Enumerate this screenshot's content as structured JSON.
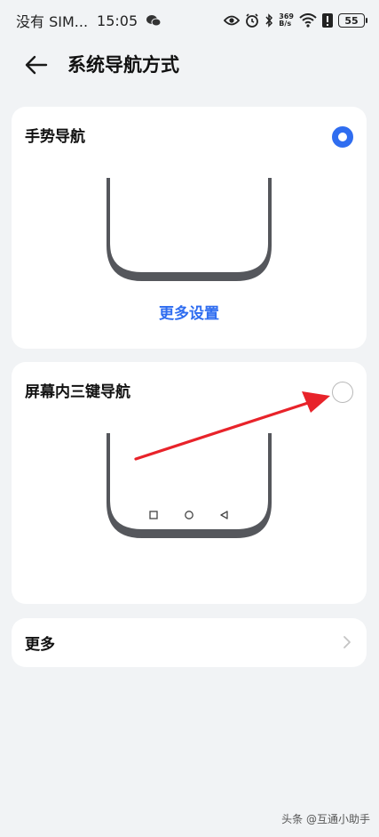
{
  "status_bar": {
    "carrier": "没有 SIM...",
    "time": "15:05",
    "net_speed_value": "369",
    "net_speed_unit": "B/s",
    "battery": "55",
    "icons": [
      "wechat-icon",
      "eye-icon",
      "alarm-icon",
      "bluetooth-icon",
      "wifi-icon",
      "alert-icon",
      "battery-icon"
    ]
  },
  "header": {
    "title": "系统导航方式"
  },
  "options": [
    {
      "title": "手势导航",
      "selected": true,
      "link_label": "更多设置"
    },
    {
      "title": "屏幕内三键导航",
      "selected": false
    }
  ],
  "more": {
    "label": "更多"
  },
  "watermark": "头条 @互通小助手",
  "colors": {
    "accent": "#2f6df0",
    "annotation_arrow": "#e8232a",
    "background": "#f1f3f5"
  }
}
